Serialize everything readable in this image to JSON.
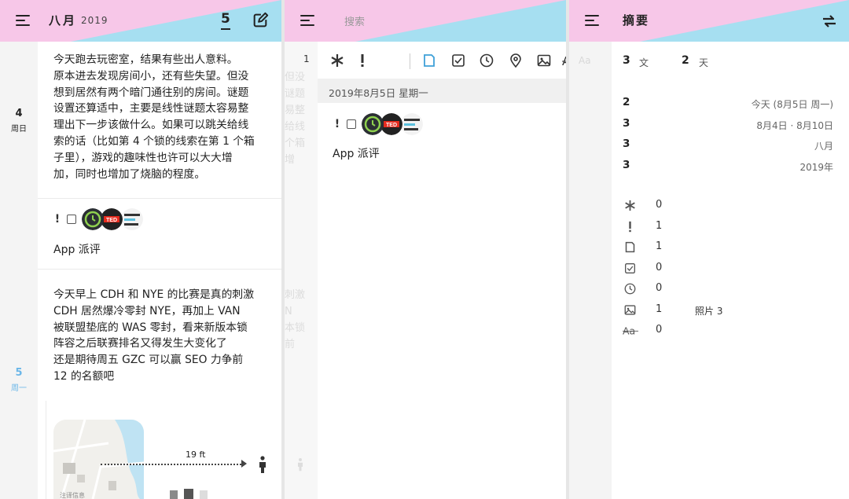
{
  "colors": {
    "header_pink": "#f7c7e8",
    "header_blue": "#a6dff1",
    "today_blue": "#6ab6e8",
    "toolbar_active": "#3fa0d8"
  },
  "timeline": {
    "header": {
      "title": "八月",
      "year": "2019",
      "count": "5",
      "menu_icon": "hamburger-icon",
      "edit_icon": "edit-icon"
    },
    "days": [
      {
        "num": "4",
        "weekday": "周日"
      },
      {
        "num": "5",
        "weekday": "周一"
      }
    ],
    "entry1_lines": [
      "今天跑去玩密室，结果有些出人意料。",
      "原本进去发现房间小，还有些失望。但没",
      "想到居然有两个暗门通往别的房间。谜题",
      "设置还算适中，主要是线性谜题太容易整",
      "理出下一步该做什么。如果可以跳关给线",
      "索的话（比如第 4 个锁的线索在第 1 个箱",
      "子里），游戏的趣味性也许可以大大增",
      "加，同时也增加了烧脑的程度。"
    ],
    "entry2": {
      "mark": "!",
      "label": "App 派评"
    },
    "entry3_lines": [
      "今天早上 CDH 和 NYE 的比赛是真的刺激",
      "CDH 居然爆冷零封 NYE，再加上 VAN",
      "被联盟垫底的 WAS 零封，看来新版本锁",
      "阵容之后联赛排名又得发生大变化了",
      "还是期待周五 GZC 可以赢 SEO 力争前",
      "12 的名额吧"
    ],
    "map": {
      "distance": "19 ft",
      "place": "注译信息"
    }
  },
  "editor": {
    "header": {
      "search_placeholder": "搜索"
    },
    "list_count": "1",
    "toolbar": [
      "asterisk-icon",
      "exclamation-icon",
      "note-icon",
      "checkbox-icon",
      "clock-icon",
      "location-icon",
      "image-icon",
      "text-style-icon"
    ],
    "date_label": "2019年8月5日 星期一",
    "entry": {
      "mark": "!",
      "label": "App 派评"
    },
    "ghost_top": [
      "但没",
      "谜题",
      "易整",
      "给线",
      "个箱",
      "增"
    ],
    "ghost_bottom": [
      "刺激",
      "N",
      "本锁",
      "",
      "前"
    ]
  },
  "summary": {
    "header": {
      "title": "摘要",
      "swap_icon": "swap-icon"
    },
    "entries_count": "3",
    "entries_unit": "文",
    "days_count": "2",
    "days_unit": "天",
    "ranges": [
      {
        "count": "2",
        "label": "今天 (8月5日 周一)"
      },
      {
        "count": "3",
        "label": "8月4日 · 8月10日"
      },
      {
        "count": "3",
        "label": "八月"
      },
      {
        "count": "3",
        "label": "2019年"
      }
    ],
    "types": [
      {
        "icon": "asterisk-icon",
        "count": "0",
        "extra": ""
      },
      {
        "icon": "exclamation-icon",
        "count": "1",
        "extra": ""
      },
      {
        "icon": "note-icon",
        "count": "1",
        "extra": ""
      },
      {
        "icon": "checkbox-icon",
        "count": "0",
        "extra": ""
      },
      {
        "icon": "clock-icon",
        "count": "0",
        "extra": ""
      },
      {
        "icon": "image-icon",
        "count": "1",
        "extra": "照片 3"
      },
      {
        "icon": "text-style-icon",
        "count": "0",
        "extra": ""
      }
    ],
    "ghost_aa": "Aa"
  }
}
